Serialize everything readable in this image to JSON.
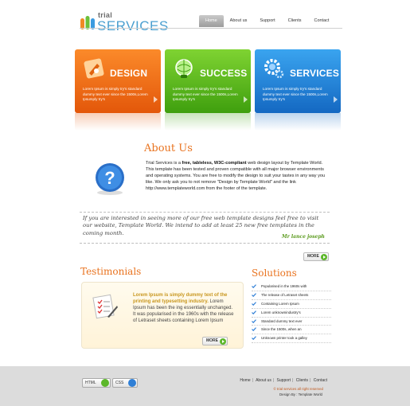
{
  "header": {
    "logo_small": "trial",
    "logo_big": "SERVICES",
    "nav": [
      "Home",
      "About us",
      "Support",
      "Clients",
      "Contact"
    ]
  },
  "features": [
    {
      "title": "DESIGN",
      "text": "Lorem Ipsum is simply try's standard dummy text ever since the 1500s,Lorem Ipsumply try's",
      "icon": "design-icon"
    },
    {
      "title": "SUCCESS",
      "text": "Lorem Ipsum is simply try's standard dummy text ever since the 1500s,Lorem Ipsumply try's",
      "icon": "success-globe-icon"
    },
    {
      "title": "SERVICES",
      "text": "Lorem Ipsum is simply try's standard dummy text ever since the 1500s,Lorem Ipsumply try's",
      "icon": "services-gear-icon"
    }
  ],
  "about": {
    "title": "About Us",
    "intro": "Trial Services is a ",
    "bold": "free, tableless, W3C-compliant",
    "body": " web design layout by Template World. This template has been tested and proven compatible with all major browser environments and operating systems. You are free to modify the design to suit your tastes in any way you like. We only ask you to not remove \"Design by Template World\" and the link http://www.templateworld.com from the footer of the template."
  },
  "quote": {
    "text": "If you are interested in seeing more of our free web template designs feel free to visit our website, Template World. We intend to add at least 25 new free templates in the coming month.",
    "author": "Mr lance joseph",
    "more_label": "MORE"
  },
  "testimonials": {
    "title": "Testimonials",
    "highlight": "Lorem Ipsum is simply dummy text of the printing and typesetting industry.",
    "text": " Lorem Ipsum has been the ing essentially unchanged. It was popularised in the 1960s with the release of Letraset sheets containing Lorem Ipsum",
    "more_label": "MORE"
  },
  "solutions": {
    "title": "Solutions",
    "items": [
      "Popularised in the 1960s with",
      "The release of Letraset sheets",
      "Containing Lorem Ipsum",
      "Lorem unknownindustry's",
      "Standard dummy text ever",
      "Since the 1500s, when an",
      "Unknown printer took a galley"
    ]
  },
  "footer": {
    "badges": [
      "HTML",
      "CSS"
    ],
    "nav": [
      "Home",
      "About us",
      "Support",
      "Clients",
      "Contact"
    ],
    "copyright": "© trial services all right reserved",
    "designby": "Design By : Template World"
  }
}
